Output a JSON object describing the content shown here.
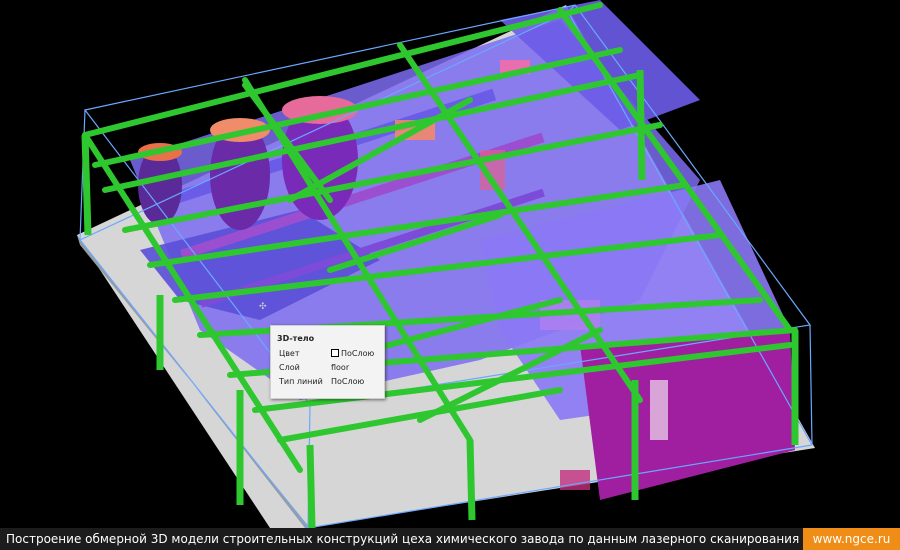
{
  "viewport": {
    "colors": {
      "background": "#000000",
      "floor": "#d8d8d8",
      "frame": "#2fc72f",
      "bbox": "#6aa8ff",
      "cloud_blue": "#7c6cf0",
      "cloud_magenta": "#a020a0",
      "cloud_orange": "#ff9a5a"
    }
  },
  "properties_panel": {
    "title": "3D-тело",
    "rows": [
      {
        "key": "Цвет",
        "value": "ПоСлою",
        "swatch": true
      },
      {
        "key": "Слой",
        "value": "floor"
      },
      {
        "key": "Тип линий",
        "value": "ПоСлою"
      }
    ],
    "grip_icon": "move-cross-icon"
  },
  "caption": {
    "text": "Построение обмерной 3D модели строительных конструкций цеха химического завода по данным лазерного сканирования",
    "url": "www.ngce.ru",
    "url_color": "#f08d16"
  }
}
